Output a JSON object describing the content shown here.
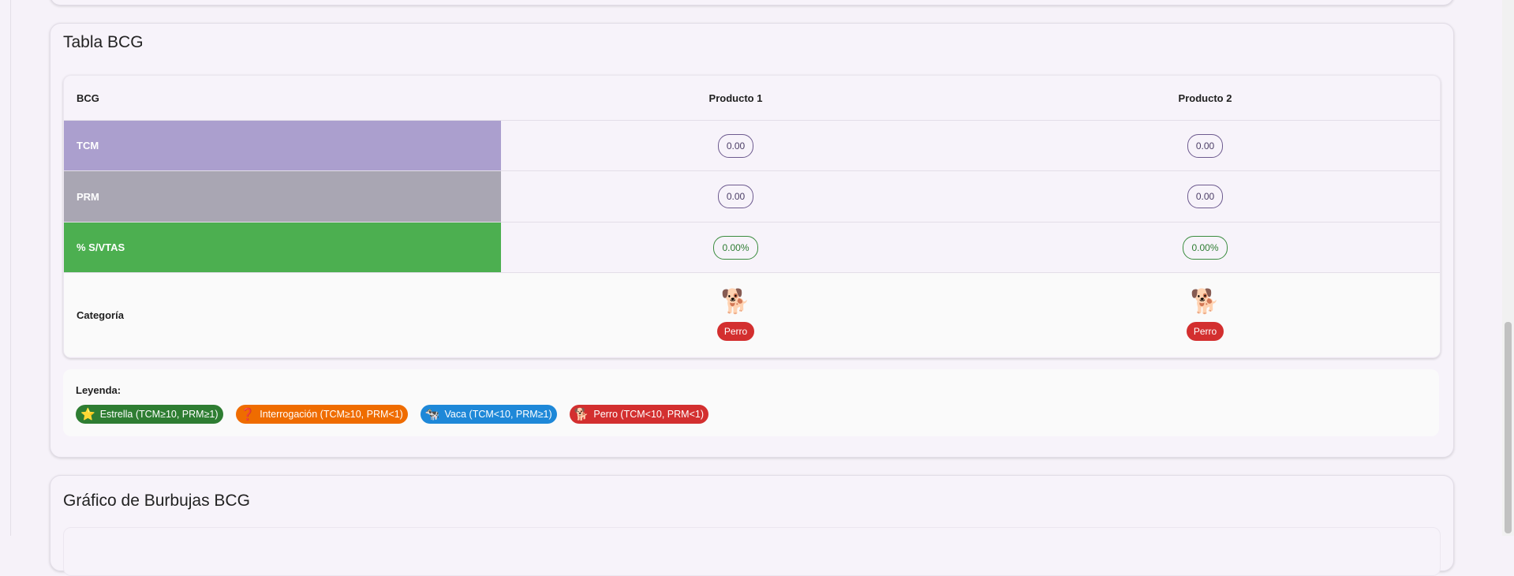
{
  "bcg_card": {
    "title": "Tabla BCG",
    "table": {
      "header": [
        "BCG",
        "Producto 1",
        "Producto 2"
      ],
      "rows": {
        "tcm": {
          "label": "TCM",
          "values": [
            "0.00",
            "0.00"
          ]
        },
        "prm": {
          "label": "PRM",
          "values": [
            "0.00",
            "0.00"
          ]
        },
        "svtas": {
          "label": "% S/VTAS",
          "values": [
            "0.00%",
            "0.00%"
          ]
        },
        "categoria": {
          "label": "Categoría",
          "icons": [
            "🐕",
            "🐕"
          ],
          "values": [
            "Perro",
            "Perro"
          ]
        }
      }
    },
    "legend": {
      "title": "Leyenda:",
      "items": [
        {
          "icon": "⭐",
          "label": "Estrella (TCM≥10, PRM≥1)",
          "color": "#2e7d32"
        },
        {
          "icon": "❓",
          "label": "Interrogación (TCM≥10, PRM<1)",
          "color": "#ef6c00"
        },
        {
          "icon": "🐄",
          "label": "Vaca (TCM<10, PRM≥1)",
          "color": "#1e88d8"
        },
        {
          "icon": "🐕",
          "label": "Perro (TCM<10, PRM<1)",
          "color": "#d32f2f"
        }
      ]
    }
  },
  "bubble_card": {
    "title": "Gráfico de Burbujas BCG"
  },
  "colors": {
    "tcm_row": "#ab9fce",
    "prm_row": "#a9a6b3",
    "svtas_row": "#4caf50",
    "category_badge": "#d32f2f"
  }
}
